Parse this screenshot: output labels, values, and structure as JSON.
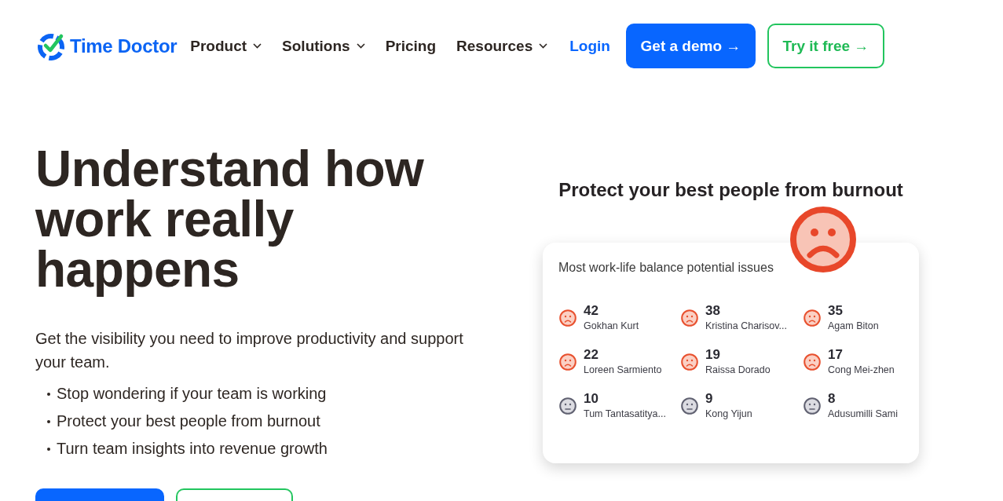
{
  "header": {
    "logo": "Time Doctor",
    "nav": [
      {
        "label": "Product",
        "dropdown": true
      },
      {
        "label": "Solutions",
        "dropdown": true
      },
      {
        "label": "Pricing",
        "dropdown": false
      },
      {
        "label": "Resources",
        "dropdown": true
      }
    ],
    "login": "Login",
    "buttons": [
      {
        "label": "Get a demo →",
        "kind": "primary"
      },
      {
        "label": "Try it free →",
        "kind": "outline"
      }
    ]
  },
  "hero": {
    "heading": "Understand how work really happens",
    "intro": "Get the visibility you need to improve productivity and support your team.",
    "bullets": [
      "Stop wondering if your team is working",
      "Protect your best people from burnout",
      "Turn team insights into revenue growth"
    ],
    "buttons": [
      {
        "kind": "primary"
      },
      {
        "kind": "outline"
      }
    ]
  },
  "widget": {
    "title": "Protect your best people from burnout",
    "card": {
      "subtitle": "Most work-life balance potential issues",
      "people": [
        {
          "count": "42",
          "name": "Gokhan Kurt",
          "kind": "sad"
        },
        {
          "count": "38",
          "name": "Kristina Charisov...",
          "kind": "sad"
        },
        {
          "count": "35",
          "name": "Agam Biton",
          "kind": "sad"
        },
        {
          "count": "22",
          "name": "Loreen Sarmiento",
          "kind": "sad"
        },
        {
          "count": "19",
          "name": "Raissa Dorado",
          "kind": "sad"
        },
        {
          "count": "17",
          "name": "Cong Mei-zhen",
          "kind": "sad"
        },
        {
          "count": "10",
          "name": "Tum Tantasatitya...",
          "kind": "neutral"
        },
        {
          "count": "9",
          "name": "Kong Yijun",
          "kind": "neutral"
        },
        {
          "count": "8",
          "name": "Adusumilli Sami",
          "kind": "neutral"
        }
      ]
    }
  }
}
